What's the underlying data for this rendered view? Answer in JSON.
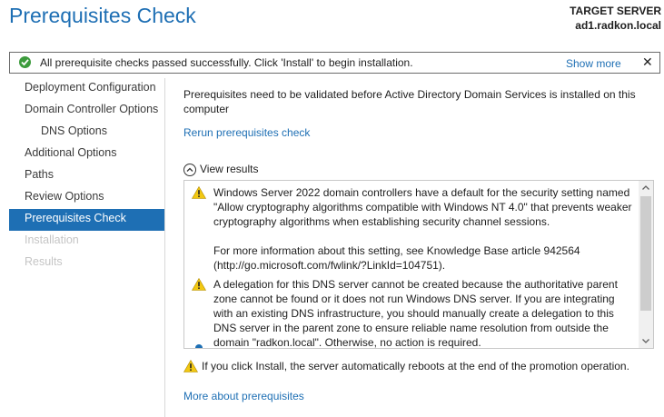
{
  "header": {
    "title": "Prerequisites Check",
    "target_label": "TARGET SERVER",
    "target_server": "ad1.radkon.local"
  },
  "notification": {
    "message": "All prerequisite checks passed successfully.  Click 'Install' to begin installation.",
    "show_more": "Show more",
    "close": "✕"
  },
  "nav": {
    "items": [
      {
        "label": "Deployment Configuration",
        "state": "normal"
      },
      {
        "label": "Domain Controller Options",
        "state": "normal"
      },
      {
        "label": "DNS Options",
        "state": "normal"
      },
      {
        "label": "Additional Options",
        "state": "normal"
      },
      {
        "label": "Paths",
        "state": "normal"
      },
      {
        "label": "Review Options",
        "state": "normal"
      },
      {
        "label": "Prerequisites Check",
        "state": "active"
      },
      {
        "label": "Installation",
        "state": "disabled"
      },
      {
        "label": "Results",
        "state": "disabled"
      }
    ]
  },
  "content": {
    "intro": "Prerequisites need to be validated before Active Directory Domain Services is installed on this computer",
    "rerun_link": "Rerun prerequisites check",
    "view_results": "View results",
    "results": [
      {
        "icon": "warning-icon",
        "paragraph1": "Windows Server 2022 domain controllers have a default for the security setting named \"Allow cryptography algorithms compatible with Windows NT 4.0\" that prevents weaker cryptography algorithms when establishing security channel sessions.",
        "paragraph2": "For more information about this setting, see Knowledge Base article 942564 (http://go.microsoft.com/fwlink/?LinkId=104751)."
      },
      {
        "icon": "warning-icon",
        "paragraph1": "A delegation for this DNS server cannot be created because the authoritative parent zone cannot be found or it does not run Windows DNS server. If you are integrating with an existing DNS infrastructure, you should manually create a delegation to this DNS server in the parent zone to ensure reliable name resolution from outside the domain \"radkon.local\". Otherwise, no action is required."
      }
    ],
    "footer_warning": "If you click Install, the server automatically reboots at the end of the promotion operation.",
    "more_link": "More about prerequisites"
  },
  "colors": {
    "accent": "#1e6fb4",
    "success": "#3c9b3c",
    "warning": "#f2c811"
  }
}
